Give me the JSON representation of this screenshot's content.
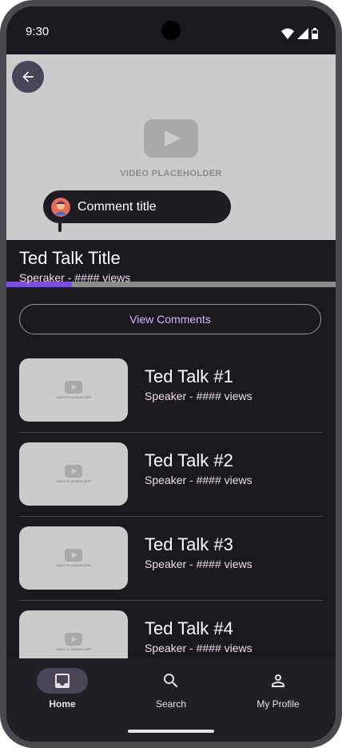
{
  "status_bar": {
    "time": "9:30"
  },
  "video": {
    "placeholder_text": "VIDEO PLACEHOLDER",
    "comment_title": "Comment title",
    "progress_fraction": 0.2
  },
  "talk": {
    "title": "Ted Talk Title",
    "meta": "Speraker - #### views"
  },
  "view_comments_label": "View Comments",
  "list": {
    "thumb_placeholder": "VIDEO PLACEHOLDER",
    "items": [
      {
        "title": "Ted Talk #1",
        "meta": "Speaker - #### views"
      },
      {
        "title": "Ted Talk #2",
        "meta": "Speaker - #### views"
      },
      {
        "title": "Ted Talk #3",
        "meta": "Speaker - #### views"
      },
      {
        "title": "Ted Talk #4",
        "meta": "Speaker - #### views"
      }
    ]
  },
  "bottom_nav": {
    "items": [
      {
        "label": "Home",
        "icon": "inbox-icon",
        "active": true
      },
      {
        "label": "Search",
        "icon": "search-icon",
        "active": false
      },
      {
        "label": "My Profile",
        "icon": "person-icon",
        "active": false
      }
    ]
  },
  "colors": {
    "background": "#1b1820",
    "accent": "#7b4fe0",
    "accent_text": "#cfbcff",
    "placeholder": "#cbcbcb"
  }
}
